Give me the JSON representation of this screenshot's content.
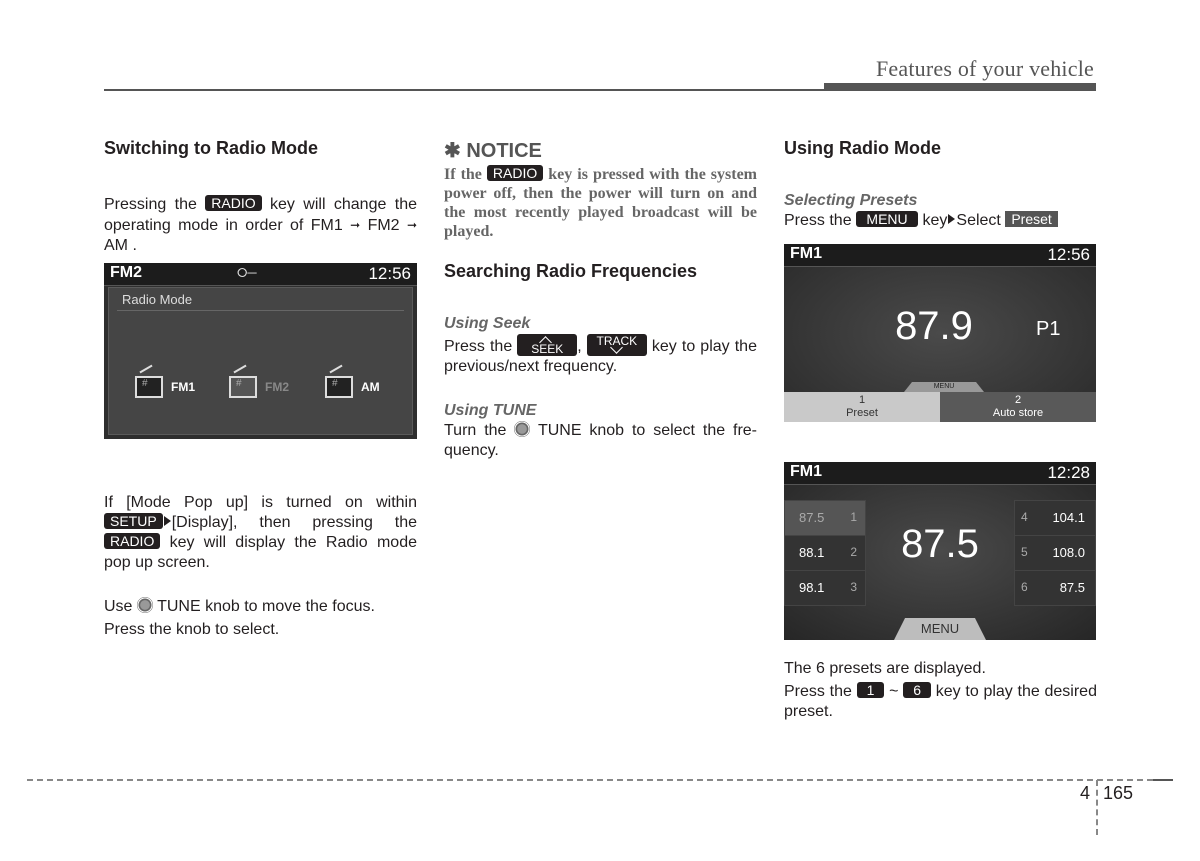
{
  "header": {
    "title": "Features of your vehicle"
  },
  "col1": {
    "heading": "Switching to Radio Mode",
    "p1_pre": "Pressing the",
    "p1_key": "RADIO",
    "p1_post": "key will change the operating mode in order of FM1",
    "p1_mid": "FM2",
    "p1_end": "AM .",
    "arrow": "➞",
    "screen": {
      "band": "FM2",
      "usb_icon": "⭘",
      "clock": "12:56",
      "panel_title": "Radio Mode",
      "modes": [
        {
          "label": "FM1",
          "active": false
        },
        {
          "label": "FM2",
          "active": true
        },
        {
          "label": "AM",
          "active": false
        }
      ]
    },
    "p2_pre": "If [Mode Pop up] is turned on within",
    "p2_key1": "SETUP",
    "p2_mid": "[Display], then pressing the",
    "p2_key2": "RADIO",
    "p2_post": "key will display the Radio mode pop up screen.",
    "p3_pre": "Use",
    "p3_post": "TUNE knob to move the focus.",
    "p4": "Press the knob to select."
  },
  "col2": {
    "notice_title": "✱ NOTICE",
    "notice_pre": "If the",
    "notice_key": "RADIO",
    "notice_post": "key is pressed with the system power off, then the power will turn on and the most recently played broadcast will be played.",
    "heading": "Searching Radio Frequencies",
    "seek_sub": "Using Seek",
    "seek_pre": "Press the",
    "seek_key": "SEEK",
    "seek_comma": ",",
    "track_key": "TRACK",
    "seek_post": "key to play the previous/next frequency.",
    "tune_sub": "Using TUNE",
    "tune_pre": "Turn the",
    "tune_post": "TUNE knob to select the fre-quency."
  },
  "col3": {
    "heading": "Using Radio Mode",
    "sub": "Selecting Presets",
    "p1_pre": "Press the",
    "p1_key": "MENU",
    "p1_mid": "key",
    "p1_select": "Select",
    "p1_preset": "Preset",
    "screen1": {
      "band": "FM1",
      "clock": "12:56",
      "frequency": "87.9",
      "preset": "P1",
      "menu_tab": "MENU",
      "buttons": [
        {
          "num": "1",
          "label": "Preset"
        },
        {
          "num": "2",
          "label": "Auto store"
        }
      ]
    },
    "screen2": {
      "band": "FM1",
      "clock": "12:28",
      "frequency": "87.5",
      "presets_left": [
        {
          "freq": "87.5",
          "num": "1"
        },
        {
          "freq": "88.1",
          "num": "2"
        },
        {
          "freq": "98.1",
          "num": "3"
        }
      ],
      "presets_right": [
        {
          "num": "4",
          "freq": "104.1"
        },
        {
          "num": "5",
          "freq": "108.0"
        },
        {
          "num": "6",
          "freq": "87.5"
        }
      ],
      "menu_button": "MENU"
    },
    "p2": "The 6 presets are displayed.",
    "p3_pre": "Press the",
    "p3_key1": "1",
    "p3_tilde": "~",
    "p3_key2": "6",
    "p3_post": "key to play the desired preset."
  },
  "footer": {
    "chapter": "4",
    "page": "165"
  }
}
